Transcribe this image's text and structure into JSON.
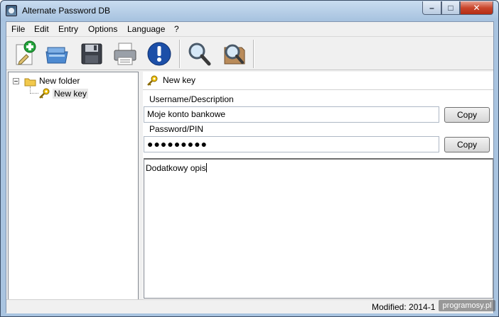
{
  "window": {
    "title": "Alternate Password DB"
  },
  "menu": [
    "File",
    "Edit",
    "Entry",
    "Options",
    "Language",
    "?"
  ],
  "toolbar": {
    "buttons": [
      "new-entry-icon",
      "open-icon",
      "save-icon",
      "print-icon",
      "info-icon",
      "search-icon",
      "search-folder-icon"
    ]
  },
  "tree": {
    "folder": "New folder",
    "key": "New key"
  },
  "entry": {
    "title": "New key",
    "username_label": "Username/Description",
    "username_value": "Moje konto bankowe",
    "password_label": "Password/PIN",
    "password_value": "●●●●●●●●●",
    "copy_label": "Copy",
    "notes": "Dodatkowy opis"
  },
  "status": {
    "modified": "Modified: 2014-1",
    "watermark": "programosy.pl"
  },
  "colors": {
    "title_gradient_top": "#c9dcf0",
    "close_button": "#c9462c",
    "folder": "#f2c94c",
    "key": "#d9a400"
  }
}
